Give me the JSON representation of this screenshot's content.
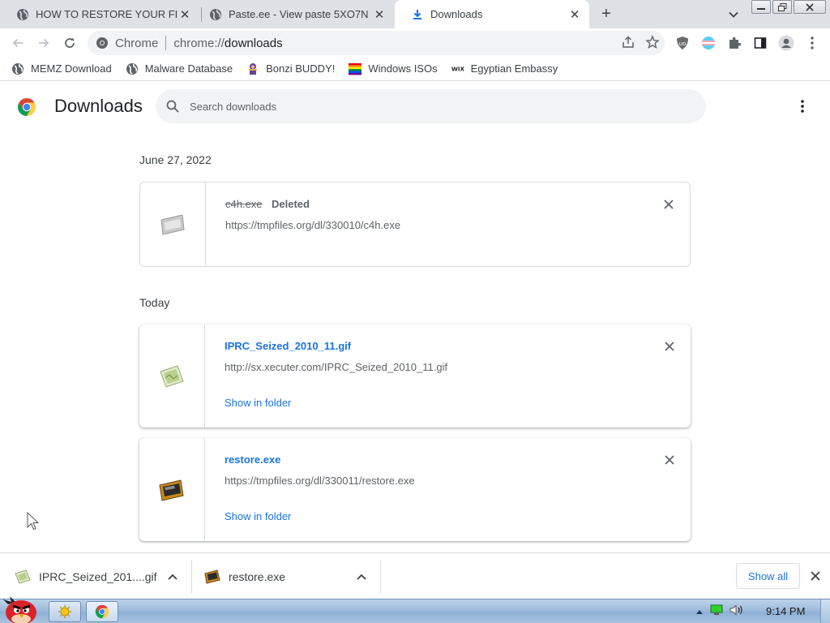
{
  "tabs": [
    {
      "title": "HOW TO RESTORE YOUR FILES",
      "icon": "globe-icon"
    },
    {
      "title": "Paste.ee - View paste 5XO7N",
      "icon": "globe-icon"
    },
    {
      "title": "Downloads",
      "icon": "download-icon",
      "active": true
    }
  ],
  "toolbar": {
    "site_chip": "Chrome",
    "url_scheme": "chrome://",
    "url_host": "downloads"
  },
  "bookmarks": [
    {
      "label": "MEMZ Download",
      "icon": "globe-icon"
    },
    {
      "label": "Malware Database",
      "icon": "globe-icon"
    },
    {
      "label": "Bonzi BUDDY!",
      "icon": "bonzi-icon"
    },
    {
      "label": "Windows ISOs",
      "icon": "rainbow-flag-icon"
    },
    {
      "label": "Egyptian Embassy",
      "icon": "wix-icon"
    }
  ],
  "page": {
    "title": "Downloads",
    "search_placeholder": "Search downloads"
  },
  "groups": [
    {
      "date": "June 27, 2022",
      "items": [
        {
          "filename": "c4h.exe",
          "status": "Deleted",
          "url": "https://tmpfiles.org/dl/330010/c4h.exe",
          "deleted": true
        }
      ]
    },
    {
      "date": "Today",
      "items": [
        {
          "filename": "IPRC_Seized_2010_11.gif",
          "url": "http://sx.xecuter.com/IPRC_Seized_2010_11.gif",
          "action": "Show in folder"
        },
        {
          "filename": "restore.exe",
          "url": "https://tmpfiles.org/dl/330011/restore.exe",
          "action": "Show in folder"
        }
      ]
    }
  ],
  "shelf": {
    "items": [
      {
        "name": "IPRC_Seized_201....gif"
      },
      {
        "name": "restore.exe"
      }
    ],
    "show_all": "Show all"
  },
  "taskbar": {
    "clock": "9:14 PM"
  }
}
